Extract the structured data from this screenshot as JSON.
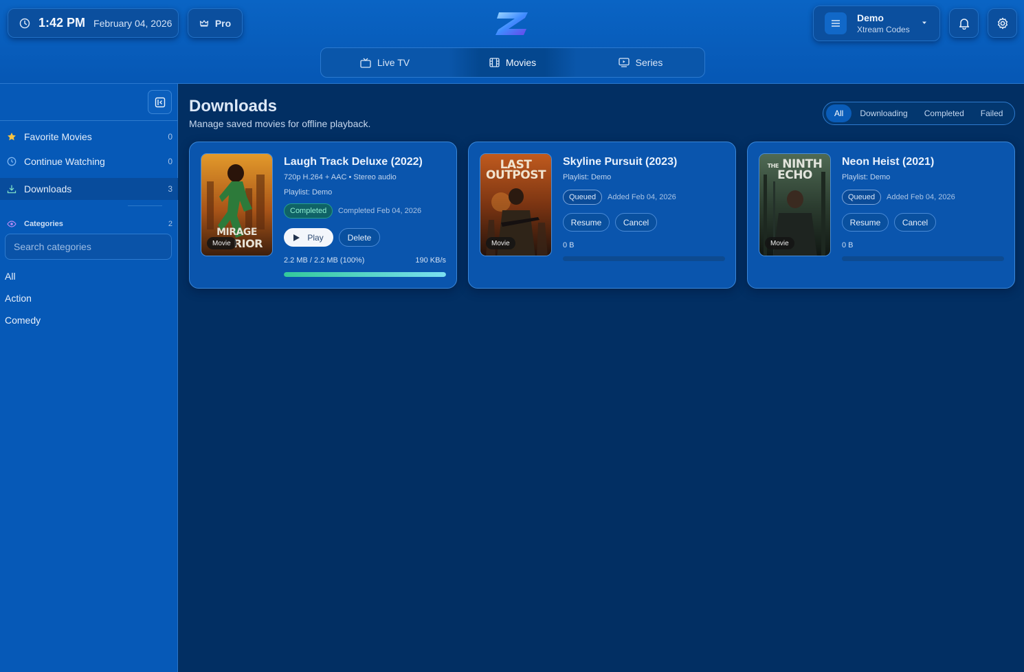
{
  "header": {
    "time": "1:42 PM",
    "date": "February 04, 2026",
    "pro_label": "Pro",
    "account": {
      "name": "Demo",
      "subtitle": "Xtream Codes"
    },
    "tabs": [
      {
        "label": "Live TV",
        "icon": "tv-icon"
      },
      {
        "label": "Movies",
        "icon": "film-icon",
        "active": true
      },
      {
        "label": "Series",
        "icon": "series-icon"
      }
    ]
  },
  "sidebar": {
    "items": [
      {
        "label": "Favorite Movies",
        "count": "0",
        "icon": "star-icon"
      },
      {
        "label": "Continue Watching",
        "count": "0",
        "icon": "clock-icon"
      },
      {
        "label": "Downloads",
        "count": "3",
        "icon": "download-icon",
        "active": true
      }
    ],
    "categories_label": "Categories",
    "categories_count": "2",
    "search_placeholder": "Search categories",
    "category_list": [
      "All",
      "Action",
      "Comedy"
    ]
  },
  "main": {
    "title": "Downloads",
    "subtitle": "Manage saved movies for offline playback.",
    "filters": [
      "All",
      "Downloading",
      "Completed",
      "Failed"
    ],
    "active_filter": "All",
    "cards": [
      {
        "title": "Laugh Track Deluxe (2022)",
        "specs": "720p H.264 + AAC • Stereo audio",
        "playlist": "Playlist: Demo",
        "status": "Completed",
        "status_note": "Completed Feb 04, 2026",
        "actions": [
          "Play",
          "Delete"
        ],
        "size": "2.2 MB / 2.2 MB (100%)",
        "rate": "190 KB/s",
        "progress": 1.0,
        "poster_text": [
          "MIRAGE",
          "RIOR"
        ],
        "badge": "Movie"
      },
      {
        "title": "Skyline Pursuit (2023)",
        "playlist": "Playlist: Demo",
        "status": "Queued",
        "status_note": "Added Feb 04, 2026",
        "actions": [
          "Resume",
          "Cancel"
        ],
        "size": "0 B",
        "progress": 0.0,
        "poster_text": [
          "LAST",
          "OUTPOST"
        ],
        "badge": "Movie"
      },
      {
        "title": "Neon Heist (2021)",
        "playlist": "Playlist: Demo",
        "status": "Queued",
        "status_note": "Added Feb 04, 2026",
        "actions": [
          "Resume",
          "Cancel"
        ],
        "size": "0 B",
        "progress": 0.0,
        "poster_text": [
          "THE",
          "NINTH",
          "ECHO"
        ],
        "badge": "Movie"
      }
    ]
  },
  "colors": {
    "accent": "#0a64c4",
    "background": "#022f63",
    "progress": "#33c99b"
  }
}
